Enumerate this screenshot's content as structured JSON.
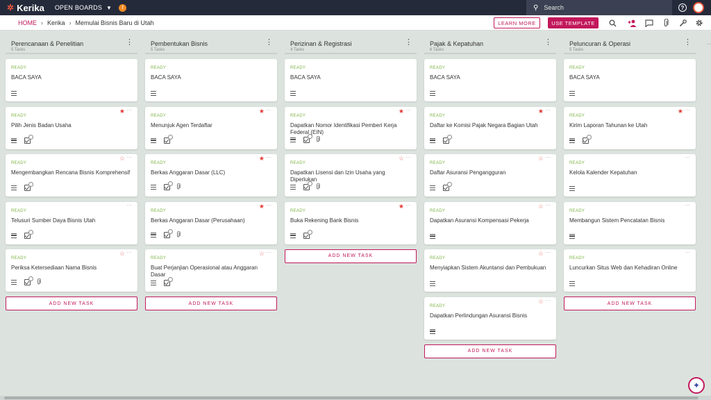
{
  "topbar": {
    "logo": "Kerika",
    "open_boards": "OPEN BOARDS",
    "search_placeholder": "Search"
  },
  "breadcrumb": {
    "home": "HOME",
    "org": "Kerika",
    "board": "Memulai Bisnis Baru di Utah"
  },
  "toolbar": {
    "learn_more": "LEARN MORE",
    "use_template": "USE TEMPLATE"
  },
  "add_task_label": "ADD NEW TASK",
  "columns": [
    {
      "title": "Perencanaan & Penelitian",
      "count": "5 Tasks",
      "cards": [
        {
          "status": "READY",
          "title": "BACA SAYA",
          "star": "none",
          "checklist": false,
          "attachment": false
        },
        {
          "status": "READY",
          "title": "Pilih Jenis Badan Usaha",
          "star": "on",
          "checklist": true,
          "attachment": false
        },
        {
          "status": "READY",
          "title": "Mengembangkan Rencana Bisnis Komprehensif",
          "star": "off",
          "checklist": true,
          "attachment": false
        },
        {
          "status": "READY",
          "title": "Telusuri Sumber Daya Bisnis Utah",
          "star": "none",
          "checklist": true,
          "attachment": false
        },
        {
          "status": "READY",
          "title": "Periksa Ketersediaan Nama Bisnis",
          "star": "off",
          "checklist": true,
          "attachment": true
        }
      ]
    },
    {
      "title": "Pembentukan Bisnis",
      "count": "5 Tasks",
      "cards": [
        {
          "status": "READY",
          "title": "BACA SAYA",
          "star": "none",
          "checklist": false,
          "attachment": false
        },
        {
          "status": "READY",
          "title": "Menunjuk Agen Terdaftar",
          "star": "on",
          "checklist": true,
          "attachment": false
        },
        {
          "status": "READY",
          "title": "Berkas Anggaran Dasar (LLC)",
          "star": "on",
          "checklist": true,
          "attachment": true
        },
        {
          "status": "READY",
          "title": "Berkas Anggaran Dasar (Perusahaan)",
          "star": "on",
          "checklist": true,
          "attachment": true
        },
        {
          "status": "READY",
          "title": "Buat Perjanjian Operasional atau Anggaran Dasar",
          "star": "off",
          "checklist": true,
          "attachment": false
        }
      ]
    },
    {
      "title": "Perizinan & Registrasi",
      "count": "4 Tasks",
      "cards": [
        {
          "status": "READY",
          "title": "BACA SAYA",
          "star": "none",
          "checklist": false,
          "attachment": false
        },
        {
          "status": "READY",
          "title": "Dapatkan Nomor Identifikasi Pemberi Kerja Federal (EIN)",
          "star": "on",
          "checklist": true,
          "attachment": true
        },
        {
          "status": "READY",
          "title": "Dapatkan Lisensi dan Izin Usaha yang Diperlukan",
          "star": "off",
          "checklist": true,
          "attachment": true
        },
        {
          "status": "READY",
          "title": "Buka Rekening Bank Bisnis",
          "star": "on",
          "checklist": true,
          "attachment": false
        }
      ]
    },
    {
      "title": "Pajak & Kepatuhan",
      "count": "6 Tasks",
      "cards": [
        {
          "status": "READY",
          "title": "BACA SAYA",
          "star": "none",
          "checklist": false,
          "attachment": false
        },
        {
          "status": "READY",
          "title": "Daftar ke Komisi Pajak Negara Bagian Utah",
          "star": "on",
          "checklist": true,
          "attachment": false
        },
        {
          "status": "READY",
          "title": "Daftar Asuransi Pengangguran",
          "star": "off",
          "checklist": true,
          "attachment": false
        },
        {
          "status": "READY",
          "title": "Dapatkan Asuransi Kompensasi Pekerja",
          "star": "off",
          "checklist": false,
          "attachment": false
        },
        {
          "status": "READY",
          "title": "Menyiapkan Sistem Akuntansi dan Pembukuan",
          "star": "off",
          "checklist": false,
          "attachment": false
        },
        {
          "status": "READY",
          "title": "Dapatkan Perlindungan Asuransi Bisnis",
          "star": "off",
          "checklist": false,
          "attachment": false
        }
      ]
    },
    {
      "title": "Peluncuran & Operasi",
      "count": "5 Tasks",
      "cards": [
        {
          "status": "READY",
          "title": "BACA SAYA",
          "star": "none",
          "checklist": false,
          "attachment": false
        },
        {
          "status": "READY",
          "title": "Kirim Laporan Tahunan ke Utah",
          "star": "on",
          "checklist": true,
          "attachment": false
        },
        {
          "status": "READY",
          "title": "Kelola Kalender Kepatuhan",
          "star": "none",
          "checklist": false,
          "attachment": false
        },
        {
          "status": "READY",
          "title": "Membangun Sistem Pencatatan Bisnis",
          "star": "none",
          "checklist": false,
          "attachment": false
        },
        {
          "status": "READY",
          "title": "Luncurkan Situs Web dan Kehadiran Online",
          "star": "none",
          "checklist": false,
          "attachment": false
        }
      ]
    }
  ],
  "colors": {
    "topbar": "#242a3a",
    "accent": "#c2185b",
    "ready": "#7cb342",
    "star": "#e53935",
    "board_bg": "#dce3df"
  },
  "icons": {
    "logo": "kerika-logo-icon",
    "search": "search-icon",
    "help": "help-icon",
    "toolbar": [
      "search-icon",
      "add-person-icon",
      "chat-icon",
      "paperclip-icon",
      "wrench-icon",
      "gear-icon"
    ],
    "assistant": "sparkle-icon"
  }
}
